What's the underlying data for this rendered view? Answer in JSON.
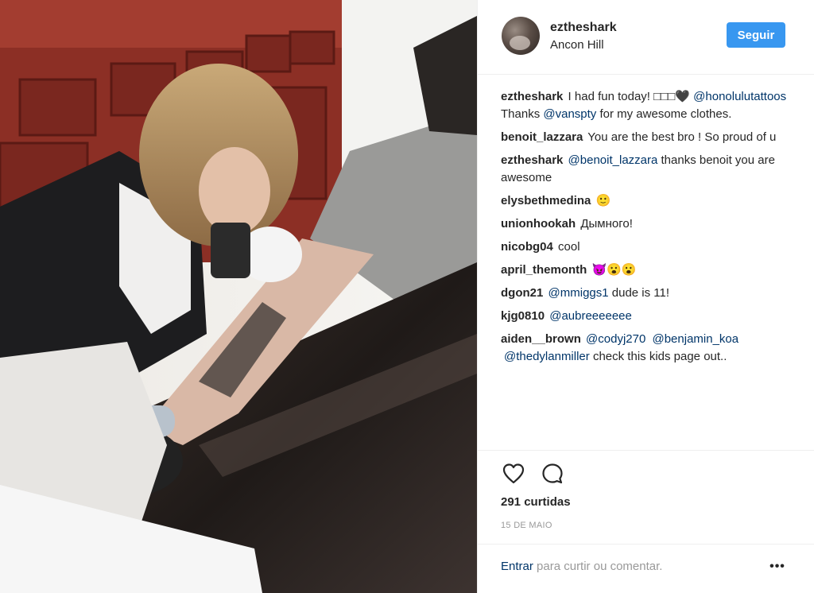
{
  "post": {
    "username": "eztheshark",
    "location": "Ancon Hill",
    "follow_label": "Seguir"
  },
  "comments": [
    {
      "user": "eztheshark",
      "parts": [
        {
          "text": "I had fun today! □□□🖤",
          "mention": false
        },
        {
          "text": "@honolulutattoos",
          "mention": true
        },
        {
          "text": "Thanks",
          "mention": false
        },
        {
          "text": "@vanspty",
          "mention": true
        },
        {
          "text": "for my awesome clothes.",
          "mention": false
        }
      ]
    },
    {
      "user": "benoit_lazzara",
      "parts": [
        {
          "text": "You are the best bro ! So proud of u",
          "mention": false
        }
      ]
    },
    {
      "user": "eztheshark",
      "parts": [
        {
          "text": "@benoit_lazzara",
          "mention": true
        },
        {
          "text": "thanks benoit you are awesome",
          "mention": false
        }
      ]
    },
    {
      "user": "elysbethmedina",
      "parts": [
        {
          "text": "🙂",
          "mention": false
        }
      ]
    },
    {
      "user": "unionhookah",
      "parts": [
        {
          "text": "Дымного!",
          "mention": false
        }
      ]
    },
    {
      "user": "nicobg04",
      "parts": [
        {
          "text": "cool",
          "mention": false
        }
      ]
    },
    {
      "user": "april_themonth",
      "parts": [
        {
          "text": "😈😮😮",
          "mention": false
        }
      ]
    },
    {
      "user": "dgon21",
      "parts": [
        {
          "text": "@mmiggs1",
          "mention": true
        },
        {
          "text": "dude is 11!",
          "mention": false
        }
      ]
    },
    {
      "user": "kjg0810",
      "parts": [
        {
          "text": "@aubreeeeeee",
          "mention": true
        }
      ]
    },
    {
      "user": "aiden__brown",
      "parts": [
        {
          "text": "@codyj270",
          "mention": true
        },
        {
          "text": "@benjamin_koa",
          "mention": true
        },
        {
          "text": "@thedylanmiller",
          "mention": true
        },
        {
          "text": "check this kids page out..",
          "mention": false
        }
      ]
    }
  ],
  "actions": {
    "like_icon": "heart-outline-icon",
    "comment_icon": "speech-bubble-icon",
    "likes_text": "291 curtidas",
    "date": "15 DE MAIO"
  },
  "add_comment": {
    "login_link": "Entrar",
    "prompt": "para curtir ou comentar.",
    "more_label": "•••",
    "more_icon": "ellipsis-icon"
  },
  "colors": {
    "accent": "#3897f0",
    "link": "#003569",
    "muted": "#999999",
    "text": "#262626",
    "border": "#efefef"
  }
}
